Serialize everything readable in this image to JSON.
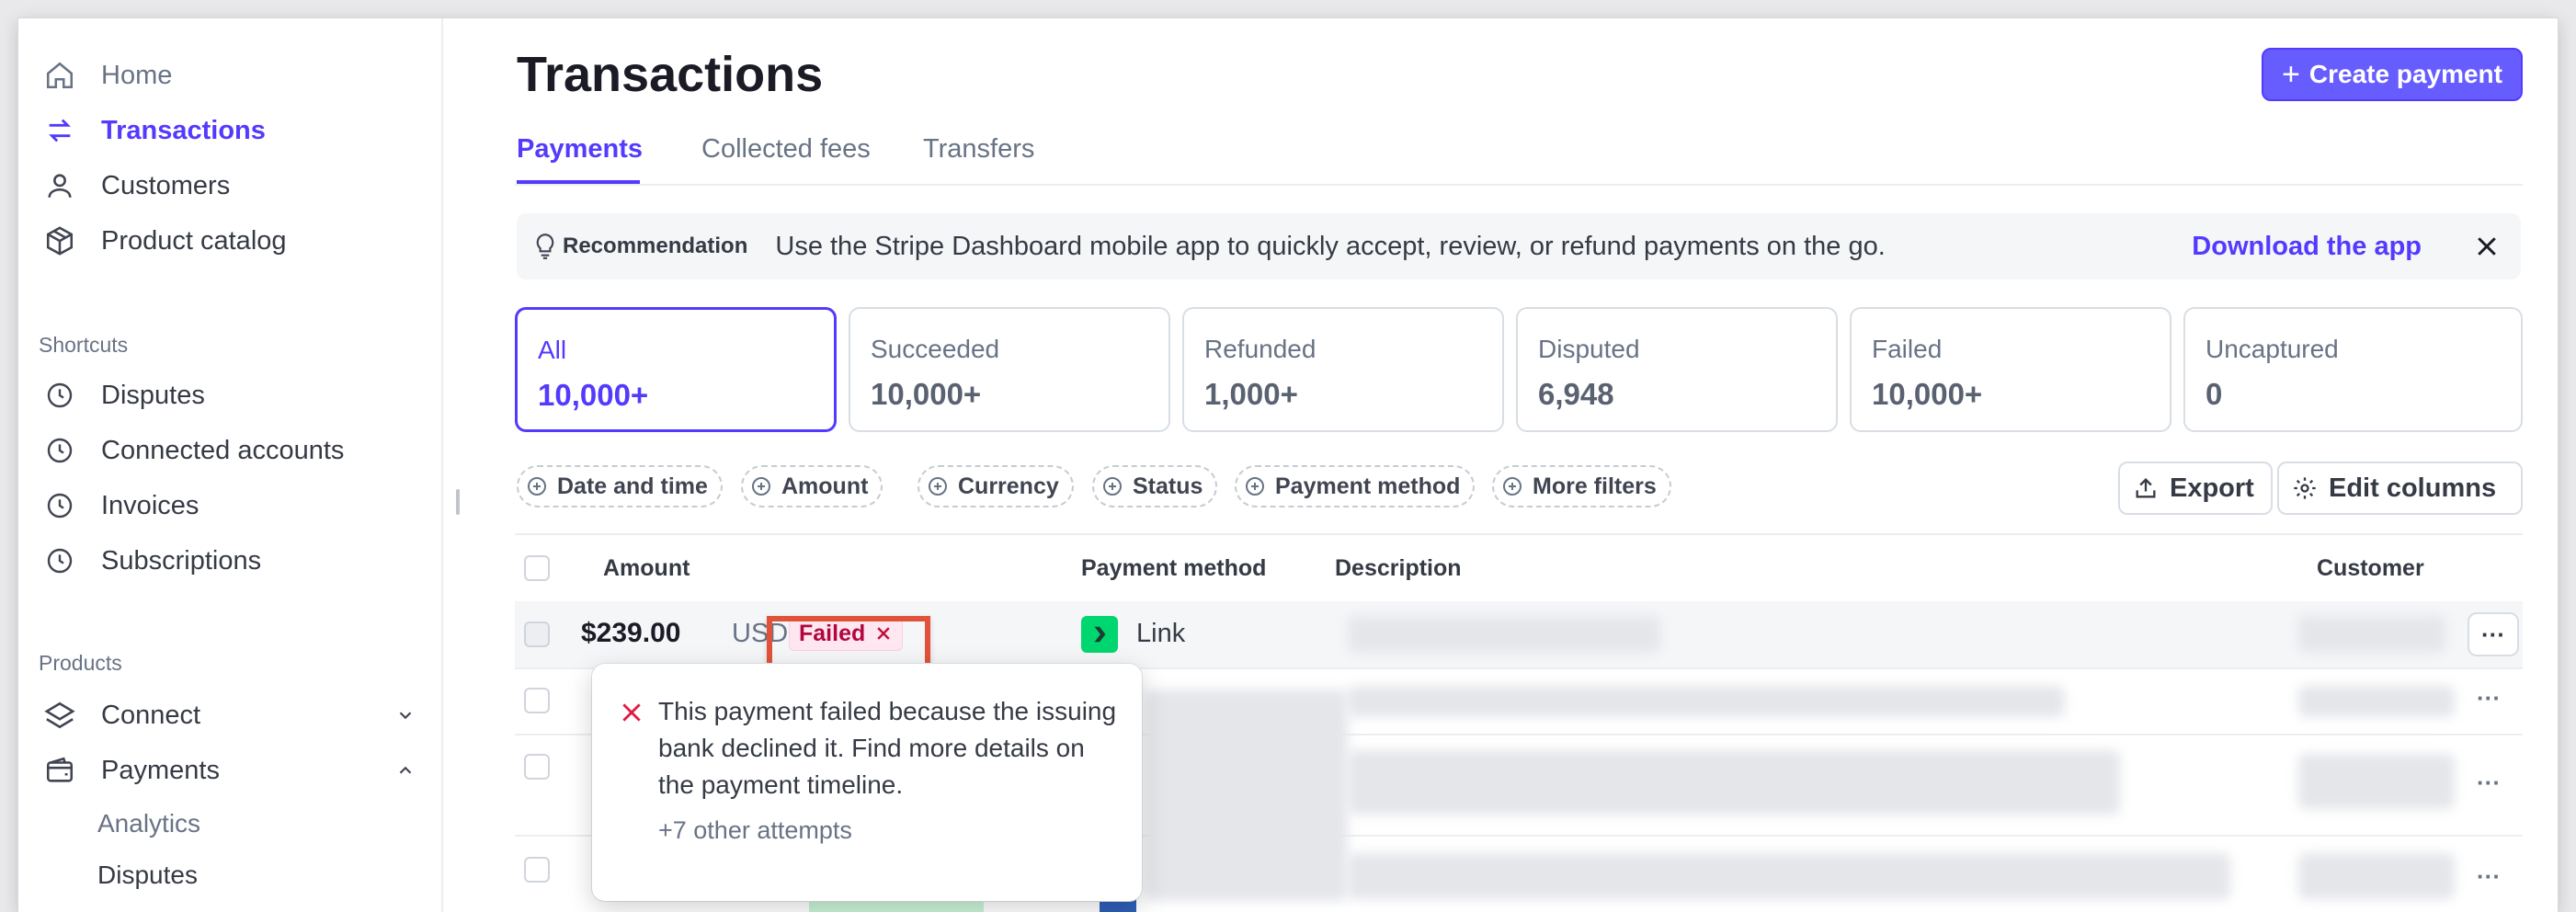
{
  "sidebar": {
    "nav": [
      {
        "label": "Home",
        "icon": "home-icon"
      },
      {
        "label": "Transactions",
        "icon": "transfer-arrows-icon"
      },
      {
        "label": "Customers",
        "icon": "user-icon"
      },
      {
        "label": "Product catalog",
        "icon": "package-icon"
      }
    ],
    "shortcuts_label": "Shortcuts",
    "shortcuts": [
      {
        "label": "Disputes",
        "icon": "clock-icon"
      },
      {
        "label": "Connected accounts",
        "icon": "clock-icon"
      },
      {
        "label": "Invoices",
        "icon": "clock-icon"
      },
      {
        "label": "Subscriptions",
        "icon": "clock-icon"
      }
    ],
    "products_label": "Products",
    "products": [
      {
        "label": "Connect",
        "icon": "layers-icon",
        "expanded": false
      },
      {
        "label": "Payments",
        "icon": "wallet-icon",
        "expanded": true
      }
    ],
    "payments_sub": [
      "Analytics",
      "Disputes"
    ]
  },
  "header": {
    "title": "Transactions",
    "create_label": "Create payment"
  },
  "tabs": [
    "Payments",
    "Collected fees",
    "Transfers"
  ],
  "recommendation": {
    "label": "Recommendation",
    "text": "Use the Stripe Dashboard mobile app to quickly accept, review, or refund payments on the go.",
    "link": "Download the app"
  },
  "status_cards": [
    {
      "label": "All",
      "value": "10,000+"
    },
    {
      "label": "Succeeded",
      "value": "10,000+"
    },
    {
      "label": "Refunded",
      "value": "1,000+"
    },
    {
      "label": "Disputed",
      "value": "6,948"
    },
    {
      "label": "Failed",
      "value": "10,000+"
    },
    {
      "label": "Uncaptured",
      "value": "0"
    }
  ],
  "filters": [
    "Date and time",
    "Amount",
    "Currency",
    "Status",
    "Payment method",
    "More filters"
  ],
  "actions": {
    "export": "Export",
    "edit_columns": "Edit columns"
  },
  "table": {
    "columns": [
      "Amount",
      "Payment method",
      "Description",
      "Customer"
    ],
    "first_row": {
      "amount": "$239.00",
      "currency": "USD",
      "status": "Failed",
      "payment_method": "Link"
    },
    "more_label": "···"
  },
  "tooltip": {
    "message": "This payment failed because the issuing bank declined it. Find more details on the payment timeline.",
    "sub": "+7 other attempts"
  },
  "colors": {
    "accent": "#533afd",
    "failed_bg": "#ffe7f2",
    "failed_text": "#b3063d",
    "highlight": "#e0533a",
    "link_green": "#00d66f"
  }
}
